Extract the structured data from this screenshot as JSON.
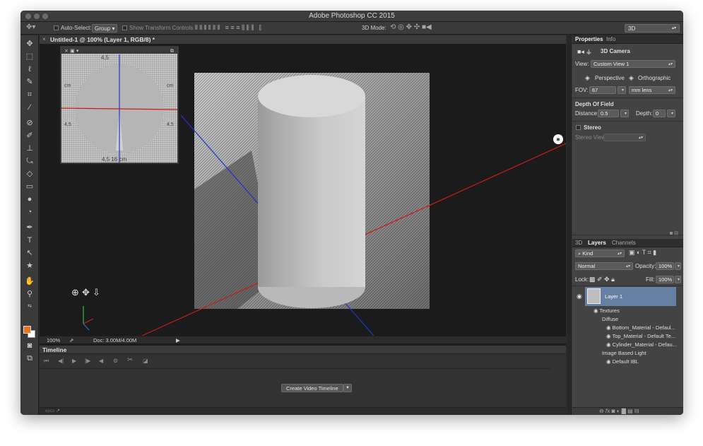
{
  "window": {
    "title": "Adobe Photoshop CC 2015"
  },
  "options_bar": {
    "auto_select_label": "Auto-Select:",
    "auto_select_value": "Group",
    "show_transform_label": "Show Transform Controls",
    "mode_label": "3D Mode:",
    "workspace": "3D"
  },
  "document": {
    "tab_title": "Untitled-1 @ 100% (Layer 1, RGB/8) *",
    "zoom": "100%",
    "doc_size": "Doc: 3.00M/4.00M"
  },
  "ruler_labels": {
    "top": "4,5",
    "bottom": "4,5 16 cm",
    "left_a": "cm",
    "left_b": "4,5",
    "right_a": "cm",
    "right_b": "4,5"
  },
  "timeline": {
    "title": "Timeline",
    "create_button": "Create Video Timeline"
  },
  "properties_panel": {
    "tabs": [
      "Properties",
      "Info"
    ],
    "header": "3D Camera",
    "view_label": "View:",
    "view_value": "Custom View 1",
    "perspective_label": "Perspective",
    "orthographic_label": "Orthographic",
    "fov_label": "FOV:",
    "fov_value": "67",
    "lens_value": "mm lens",
    "dof_title": "Depth Of Field",
    "distance_label": "Distance:",
    "distance_value": "0.5",
    "depth_label": "Depth:",
    "depth_value": "0",
    "stereo_label": "Stereo",
    "stereo_view_label": "Stereo View:"
  },
  "layers_panel": {
    "tabs": [
      "3D",
      "Layers",
      "Channels"
    ],
    "kind_label": "Kind",
    "blend_mode": "Normal",
    "opacity_label": "Opacity:",
    "opacity_value": "100%",
    "lock_label": "Lock:",
    "fill_label": "Fill:",
    "fill_value": "100%",
    "layer_name": "Layer 1",
    "textures_label": "Textures",
    "diffuse_label": "Diffuse",
    "materials": [
      "Bottom_Material - Defaul...",
      "Top_Material - Default Te...",
      "Cylinder_Material - Defau..."
    ],
    "ibl_label": "Image Based Light",
    "default_ibl": "Default IBL"
  },
  "colors": {
    "foreground": "#e8731f",
    "background": "#ffffff",
    "selected_layer": "#6580a3"
  }
}
